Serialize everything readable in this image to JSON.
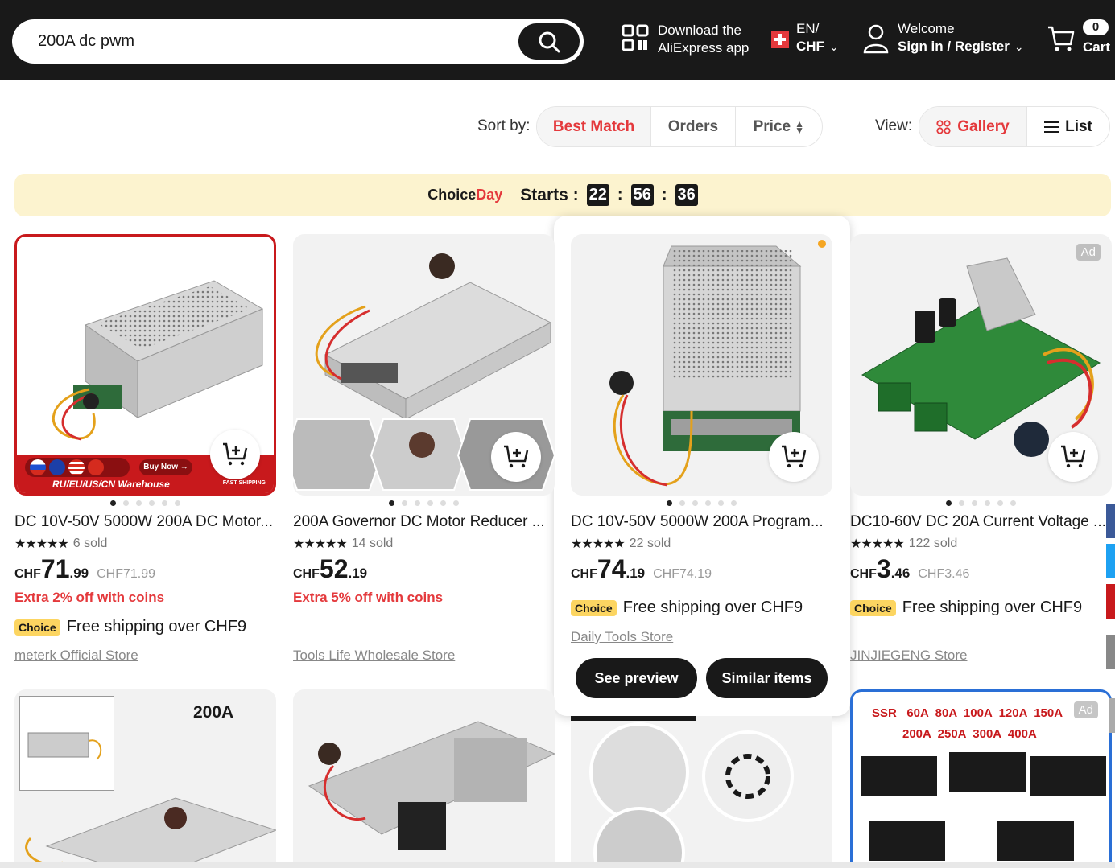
{
  "header": {
    "search_value": "200A dc pwm",
    "app_line1": "Download the",
    "app_line2": "AliExpress app",
    "lang": "EN/",
    "currency": "CHF",
    "welcome": "Welcome",
    "signin": "Sign in / Register",
    "cart_count": "0",
    "cart_label": "Cart"
  },
  "sort": {
    "label": "Sort by:",
    "options": [
      "Best Match",
      "Orders",
      "Price"
    ],
    "active": "Best Match"
  },
  "view": {
    "label": "View:",
    "gallery": "Gallery",
    "list": "List"
  },
  "banner": {
    "brand_a": "Choice",
    "brand_b": "Day",
    "starts": "Starts :",
    "h": "22",
    "m": "56",
    "s": "36"
  },
  "products": [
    {
      "title": "DC 10V-50V 5000W 200A DC Motor...",
      "stars": "★★★★★",
      "sold": "6 sold",
      "cur": "CHF",
      "int": "71",
      "dec": ".99",
      "old": "CHF71.99",
      "extra": "Extra 2% off with coins",
      "choice": "Choice",
      "ship": "Free shipping over CHF9",
      "store": "meterk Official Store",
      "warehouse": "RU/EU/US/CN Warehouse",
      "buy_now": "Buy Now →",
      "fast": "FAST SHIPPING"
    },
    {
      "title": "200A Governor DC Motor Reducer ...",
      "stars": "★★★★★",
      "sold": "14 sold",
      "cur": "CHF",
      "int": "52",
      "dec": ".19",
      "extra": "Extra 5% off with coins",
      "store": "Tools Life Wholesale Store"
    },
    {
      "title": "DC 10V-50V 5000W 200A Program...",
      "stars": "★★★★★",
      "sold": "22 sold",
      "cur": "CHF",
      "int": "74",
      "dec": ".19",
      "old": "CHF74.19",
      "choice": "Choice",
      "ship": "Free shipping over CHF9",
      "store": "Daily Tools Store",
      "preview": "See preview",
      "similar": "Similar items"
    },
    {
      "title": "DC10-60V DC 20A Current Voltage ...",
      "stars": "★★★★★",
      "sold": "122 sold",
      "cur": "CHF",
      "int": "3",
      "dec": ".46",
      "old": "CHF3.46",
      "choice": "Choice",
      "ship": "Free shipping over CHF9",
      "store": "JINJIEGENG Store",
      "ad": "Ad"
    }
  ],
  "row2": {
    "p5_label": "200A",
    "p8_line1": "SSR   60A  80A  100A  120A  150A",
    "p8_line2": "200A  250A  300A  400A",
    "p8_ad": "Ad"
  },
  "colors": {
    "accent": "#e4393c",
    "dark": "#191919",
    "choice_yellow": "#fcd561",
    "banner_bg": "#fcf3cf"
  }
}
